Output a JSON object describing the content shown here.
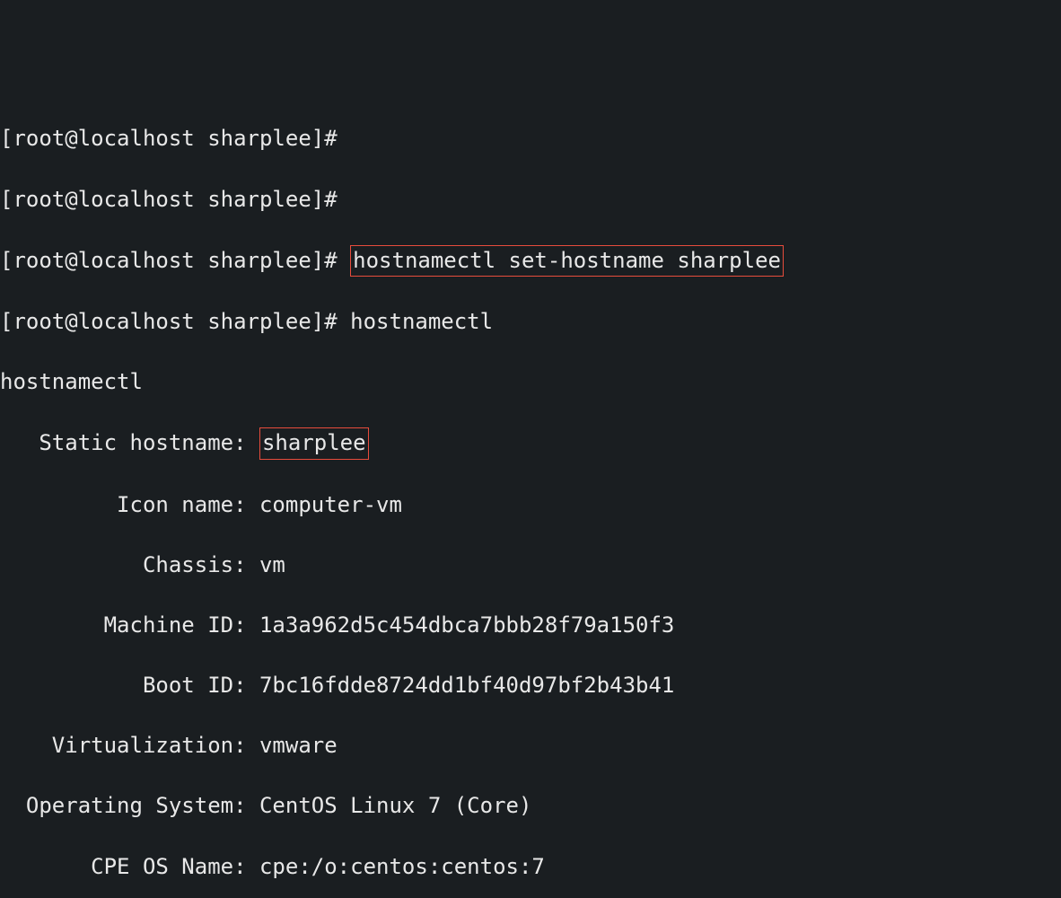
{
  "prompts": {
    "p1": "[root@localhost sharplee]# ",
    "p2": "[root@localhost sharplee]# ",
    "p3": "[root@localhost sharplee]# ",
    "p4": "[root@localhost sharplee]# "
  },
  "commands": {
    "cmd3": "hostnamectl set-hostname sharplee",
    "cmd4": "hostnamectl"
  },
  "echo": "hostnamectl",
  "output": {
    "static_hostname": {
      "label": "   Static hostname: ",
      "value": "sharplee"
    },
    "icon_name": {
      "label": "         Icon name: ",
      "value": "computer-vm"
    },
    "chassis": {
      "label": "           Chassis: ",
      "value": "vm"
    },
    "machine_id": {
      "label": "        Machine ID: ",
      "value": "1a3a962d5c454dbca7bbb28f79a150f3"
    },
    "boot_id": {
      "label": "           Boot ID: ",
      "value": "7bc16fdde8724dd1bf40d97bf2b43b41"
    },
    "virtualization": {
      "label": "    Virtualization: ",
      "value": "vmware"
    },
    "operating_system": {
      "label": "  Operating System: ",
      "value": "CentOS Linux 7 (Core)"
    },
    "cpe_os_name": {
      "label": "       CPE OS Name: ",
      "value": "cpe:/o:centos:centos:7"
    }
  }
}
